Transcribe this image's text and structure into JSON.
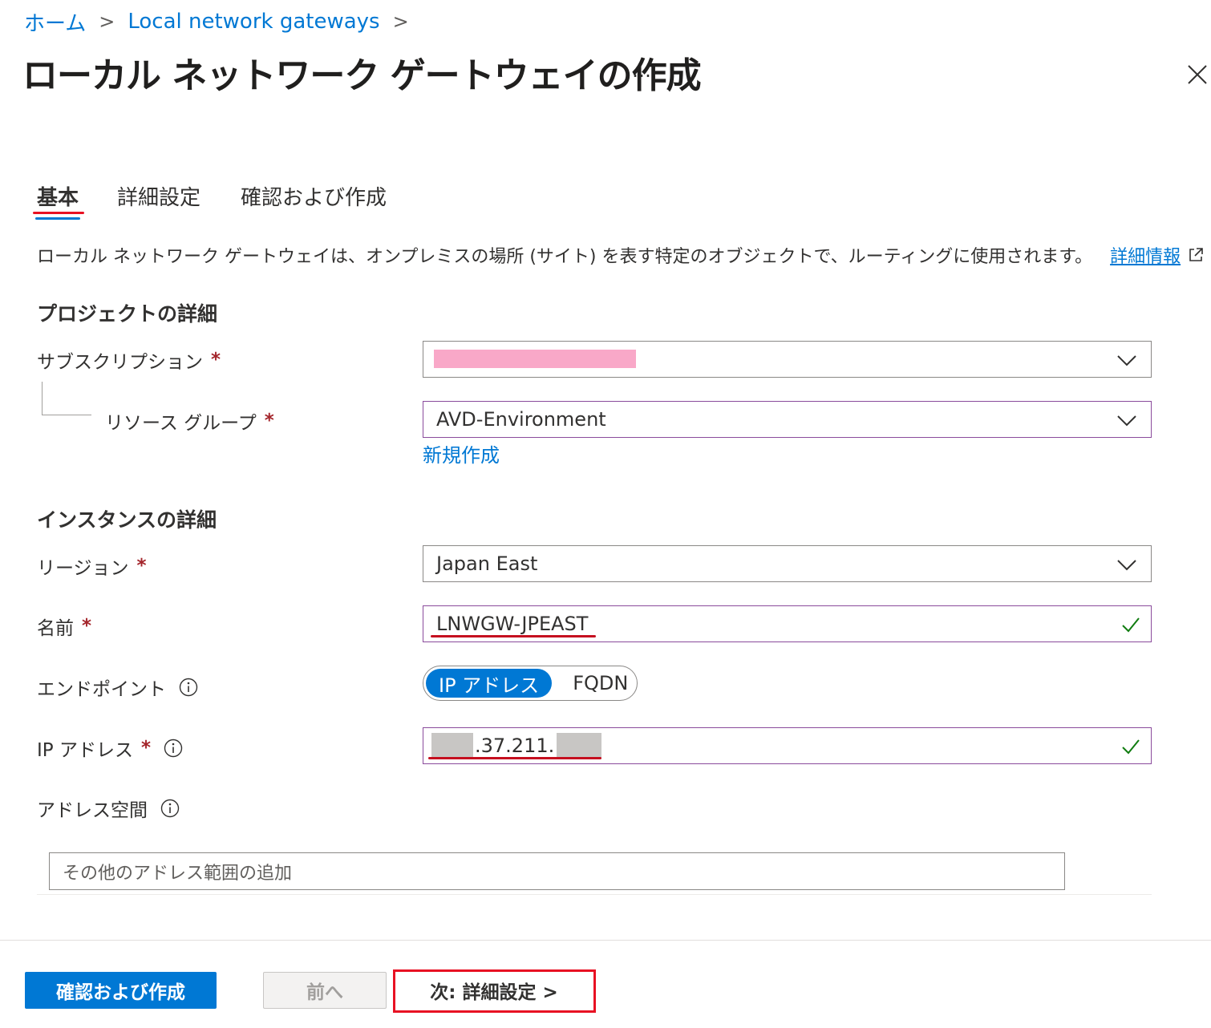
{
  "breadcrumb": {
    "home": "ホーム",
    "parent": "Local network gateways",
    "separator": ">"
  },
  "page": {
    "title": "ローカル ネットワーク ゲートウェイの作成",
    "more": "…"
  },
  "tabs": [
    {
      "label": "基本",
      "active": true
    },
    {
      "label": "詳細設定",
      "active": false
    },
    {
      "label": "確認および作成",
      "active": false
    }
  ],
  "description": {
    "text": "ローカル ネットワーク ゲートウェイは、オンプレミスの場所 (サイト) を表す特定のオブジェクトで、ルーティングに使用されます。",
    "link": "詳細情報"
  },
  "project": {
    "heading": "プロジェクトの詳細",
    "subscription_label": "サブスクリプション",
    "resource_group_label": "リソース グループ",
    "resource_group_value": "AVD-Environment",
    "new_link": "新規作成"
  },
  "instance": {
    "heading": "インスタンスの詳細",
    "region_label": "リージョン",
    "region_value": "Japan East",
    "name_label": "名前",
    "name_value": "LNWGW-JPEAST",
    "endpoint_label": "エンドポイント",
    "endpoint_options": [
      "IP アドレス",
      "FQDN"
    ],
    "endpoint_selected": "IP アドレス",
    "ip_label": "IP アドレス",
    "ip_visible": ".37.211.",
    "address_space_label": "アドレス空間",
    "address_space_placeholder": "その他のアドレス範囲の追加"
  },
  "required_mark": "*",
  "footer": {
    "review_create": "確認および作成",
    "previous": "前へ",
    "next": "次: 詳細設定 >"
  },
  "colors": {
    "accent": "#0078d4",
    "required": "#a4262c",
    "highlight": "#e81123",
    "valid": "#107c10"
  }
}
